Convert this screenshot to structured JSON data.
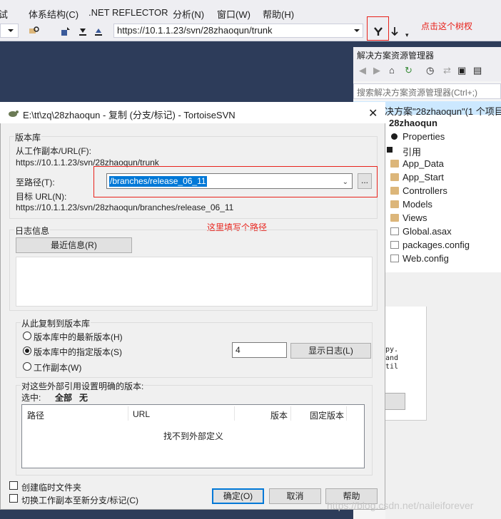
{
  "vs": {
    "menu": [
      "试",
      "体系结构(C)",
      ".NET REFLECTOR",
      "分析(N)",
      "窗口(W)",
      "帮助(H)"
    ],
    "url": "https://10.1.1.23/svn/28zhaoqun/trunk",
    "annotation_branch": "点击这个树杈"
  },
  "solution_explorer": {
    "title": "解决方案资源管理器",
    "search_placeholder": "搜索解决方案资源管理器(Ctrl+;)",
    "solution": "决方案\"28zhaoqun\"(1 个项目)",
    "project": "28zhaoqun",
    "items": [
      "Properties",
      "引用",
      "App_Data",
      "App_Start",
      "Controllers",
      "Models",
      "Views",
      "Global.asax",
      "packages.config",
      "Web.config"
    ],
    "snippet": [
      "py.",
      "and",
      "til"
    ]
  },
  "dialog": {
    "title": "E:\\tt\\zq\\28zhaoqun - 复制 (分支/标记) - TortoiseSVN",
    "repo_group": "版本库",
    "from_label": "从工作副本/URL(F):",
    "from_value": "https://10.1.1.23/svn/28zhaoqun/trunk",
    "to_label": "至路径(T):",
    "to_value": "/branches/release_06_11",
    "browse": "...",
    "target_label": "目标 URL(N):",
    "target_value": "https://10.1.1.23/svn/28zhaoqun/branches/release_06_11",
    "annotation_path": "这里填写个路径",
    "log_group": "日志信息",
    "recent_btn": "最近信息(R)",
    "copy_group": "从此复制到版本库",
    "radio_head": "版本库中的最新版本(H)",
    "radio_specific": "版本库中的指定版本(S)",
    "radio_wc": "工作副本(W)",
    "revision": "4",
    "show_log_btn": "显示日志(L)",
    "externals_group": "对这些外部引用设置明确的版本:",
    "select_label": "选中:",
    "select_all": "全部",
    "select_none": "无",
    "columns": [
      "路径",
      "URL",
      "版本",
      "固定版本"
    ],
    "empty_text": "找不到外部定义",
    "chk_temp": "创建临时文件夹",
    "chk_switch": "切换工作副本至新分支/标记(C)",
    "ok": "确定(O)",
    "cancel": "取消",
    "help": "帮助"
  },
  "watermark": "https://blog.csdn.net/naileiforever"
}
